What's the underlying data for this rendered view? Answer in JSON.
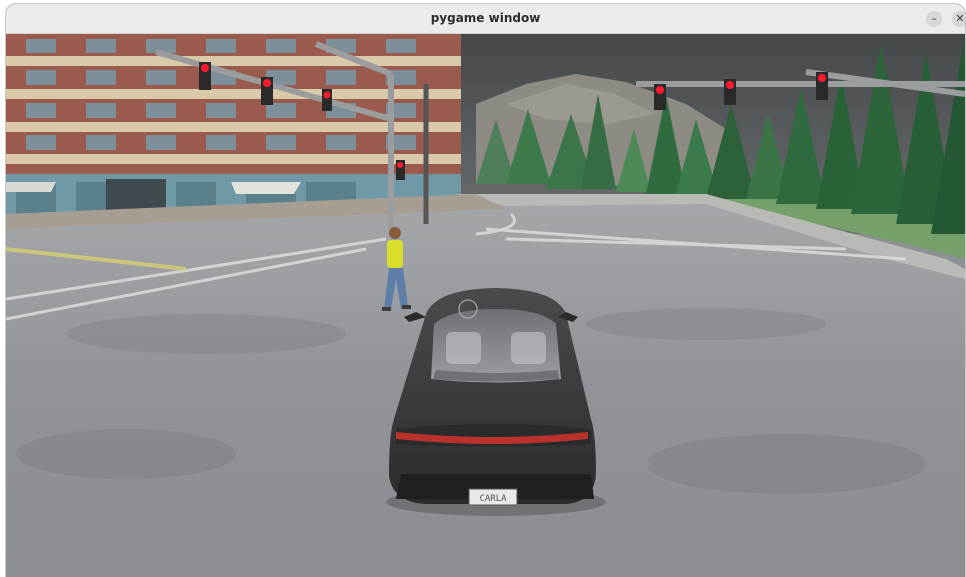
{
  "window": {
    "title": "pygame window",
    "minimize_label": "–",
    "close_label": "✕"
  },
  "scene": {
    "description_tags": [
      "building",
      "traffic-lights",
      "mountain",
      "trees",
      "pedestrian",
      "car",
      "wet-road"
    ],
    "license_plate": "CARLA",
    "colors": {
      "sky": "#4c4f52",
      "road": "#8e9195",
      "building_brick": "#9a5a4e",
      "building_trim": "#d9c9a8",
      "glass": "#6f99a6",
      "tree": "#2f6b3e",
      "grass": "#76a06a",
      "car_body": "#3a3b3d",
      "tail_light": "#d2342c",
      "signal_red": "#ff1a2e",
      "pedestrian_shirt": "#d8de2a",
      "pedestrian_pants": "#5d7ea8"
    }
  }
}
